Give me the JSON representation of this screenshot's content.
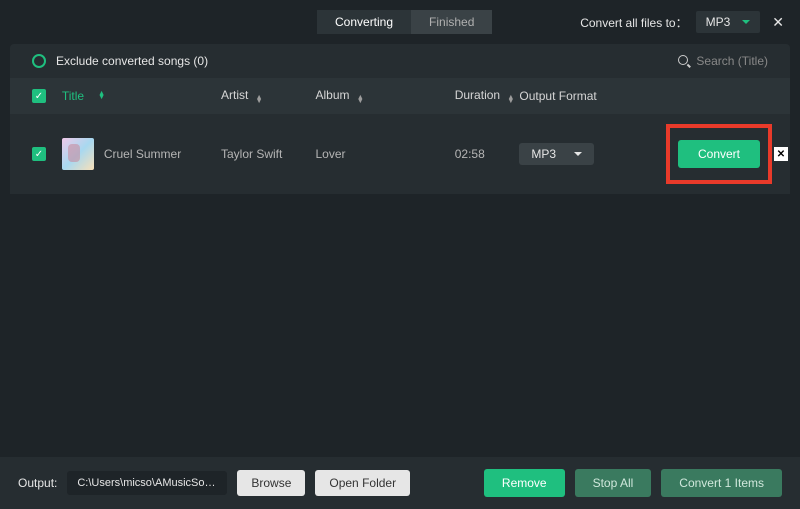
{
  "topbar": {
    "tabs": {
      "converting": "Converting",
      "finished": "Finished"
    },
    "convert_all_label": "Convert all files to：",
    "global_format": "MP3"
  },
  "toolbar": {
    "exclude_label": "Exclude converted songs (0)",
    "search_placeholder": "Search  (Title)"
  },
  "headers": {
    "title": "Title",
    "artist": "Artist",
    "album": "Album",
    "duration": "Duration",
    "output_format": "Output Format"
  },
  "rows": [
    {
      "title": "Cruel Summer",
      "artist": "Taylor Swift",
      "album": "Lover",
      "duration": "02:58",
      "format": "MP3",
      "convert_label": "Convert"
    }
  ],
  "bottom": {
    "output_label": "Output:",
    "output_path": "C:\\Users\\micso\\AMusicSoft\\...",
    "browse": "Browse",
    "open_folder": "Open Folder",
    "remove": "Remove",
    "stop_all": "Stop All",
    "convert_items": "Convert 1 Items"
  }
}
